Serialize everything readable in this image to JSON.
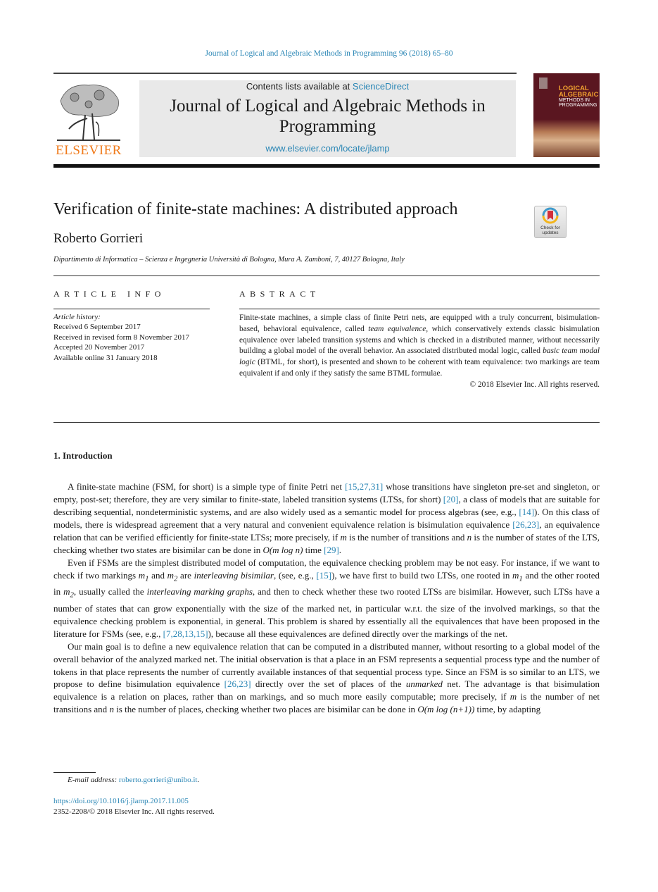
{
  "running_head": "Journal of Logical and Algebraic Methods in Programming 96 (2018) 65–80",
  "masthead": {
    "publisher_logo_text": "ELSEVIER",
    "contents_prefix": "Contents lists available at ",
    "contents_link": "ScienceDirect",
    "journal_title": "Journal of Logical and Algebraic Methods in Programming",
    "journal_url": "www.elsevier.com/locate/jlamp",
    "cover": {
      "line1": "LOGICAL",
      "line2": "ALGEBRAIC",
      "line3": "METHODS IN",
      "line4": "PROGRAMMING"
    }
  },
  "article": {
    "title": "Verification of finite-state machines: A distributed approach",
    "crossmark_label": "Check for updates",
    "author": "Roberto Gorrieri",
    "affiliation": "Dipartimento di Informatica – Scienza e Ingegneria Università di Bologna, Mura A. Zamboni, 7, 40127 Bologna, Italy"
  },
  "article_info": {
    "heading": "ARTICLE INFO",
    "history_label": "Article history:",
    "history": [
      "Received 6 September 2017",
      "Received in revised form 8 November 2017",
      "Accepted 20 November 2017",
      "Available online 31 January 2018"
    ]
  },
  "abstract": {
    "heading": "ABSTRACT",
    "t1": "Finite-state machines, a simple class of finite Petri nets, are equipped with a truly concurrent, bisimulation-based, behavioral equivalence, called ",
    "em1": "team equivalence",
    "t2": ", which conservatively extends classic bisimulation equivalence over labeled transition systems and which is checked in a distributed manner, without necessarily building a global model of the overall behavior. An associated distributed modal logic, called ",
    "em2": "basic team modal logic",
    "t3": " (BTML, for short), is presented and shown to be coherent with team equivalence: two markings are team equivalent if and only if they satisfy the same BTML formulae.",
    "copyright": "© 2018 Elsevier Inc. All rights reserved."
  },
  "section": {
    "heading": "1. Introduction",
    "p1": {
      "a": "A finite-state machine (FSM, for short) is a simple type of finite Petri net ",
      "r1": "[15,27,31]",
      "b": " whose transitions have singleton pre-set and singleton, or empty, post-set; therefore, they are very similar to finite-state, labeled transition systems (LTSs, for short) ",
      "r2": "[20]",
      "c": ", a class of models that are suitable for describing sequential, nondeterministic systems, and are also widely used as a semantic model for process algebras (see, e.g., ",
      "r3": "[14]",
      "d": "). On this class of models, there is widespread agreement that a very natural and convenient equivalence relation is bisimulation equivalence ",
      "r4": "[26,23]",
      "e": ", an equivalence relation that can be verified efficiently for finite-state LTSs; more precisely, if ",
      "m": "m",
      "f": " is the number of transitions and ",
      "n": "n",
      "g": " is the number of states of the LTS, checking whether two states are bisimilar can be done in ",
      "complexity": "O(m log n)",
      "h": " time ",
      "r5": "[29]",
      "i": "."
    },
    "p2": {
      "a": "Even if FSMs are the simplest distributed model of computation, the equivalence checking problem may be not easy. For instance, if we want to check if two markings ",
      "m1": "m1",
      "b": " and ",
      "m2": "m2",
      "c": " are ",
      "em1": "interleaving bisimilar",
      "d": ", (see, e.g., ",
      "r1": "[15]",
      "e": "), we have first to build two LTSs, one rooted in ",
      "f": " and the other rooted in ",
      "g": ", usually called the ",
      "em2": "interleaving marking graphs",
      "h": ", and then to check whether these two rooted LTSs are bisimilar. However, such LTSs have a number of states that can grow exponentially with the size of the marked net, in particular w.r.t. the size of the involved markings, so that the equivalence checking problem is exponential, in general. This problem is shared by essentially all the equivalences that have been proposed in the literature for FSMs (see, e.g., ",
      "r2": "[7,28,13,15]",
      "i": "), because all these equivalences are defined directly over the markings of the net."
    },
    "p3": {
      "a": "Our main goal is to define a new equivalence relation that can be computed in a distributed manner, without resorting to a global model of the overall behavior of the analyzed marked net. The initial observation is that a place in an FSM represents a sequential process type and the number of tokens in that place represents the number of currently available instances of that sequential process type. Since an FSM is so similar to an LTS, we propose to define bisimulation equivalence ",
      "r1": "[26,23]",
      "b": " directly over the set of places of the ",
      "em1": "unmarked",
      "c": " net. The advantage is that bisimulation equivalence is a relation on places, rather than on markings, and so much more easily computable; more precisely, if ",
      "d": " is the number of net transitions and ",
      "e": " is the number of places, checking whether two places are bisimilar can be done in ",
      "complexity": "O(m log (n+1))",
      "f": " time, by adapting"
    }
  },
  "footnote": {
    "label": "E-mail address:",
    "email": "roberto.gorrieri@unibo.it",
    "end": "."
  },
  "doi": {
    "url": "https://doi.org/10.1016/j.jlamp.2017.11.005",
    "issn_line": "2352-2208/© 2018 Elsevier Inc. All rights reserved."
  },
  "colors": {
    "link": "#2a86b5",
    "elsevier_orange": "#f07a1a",
    "banner_bg": "#e9e9e9",
    "cover_bg": "#5a1620"
  }
}
